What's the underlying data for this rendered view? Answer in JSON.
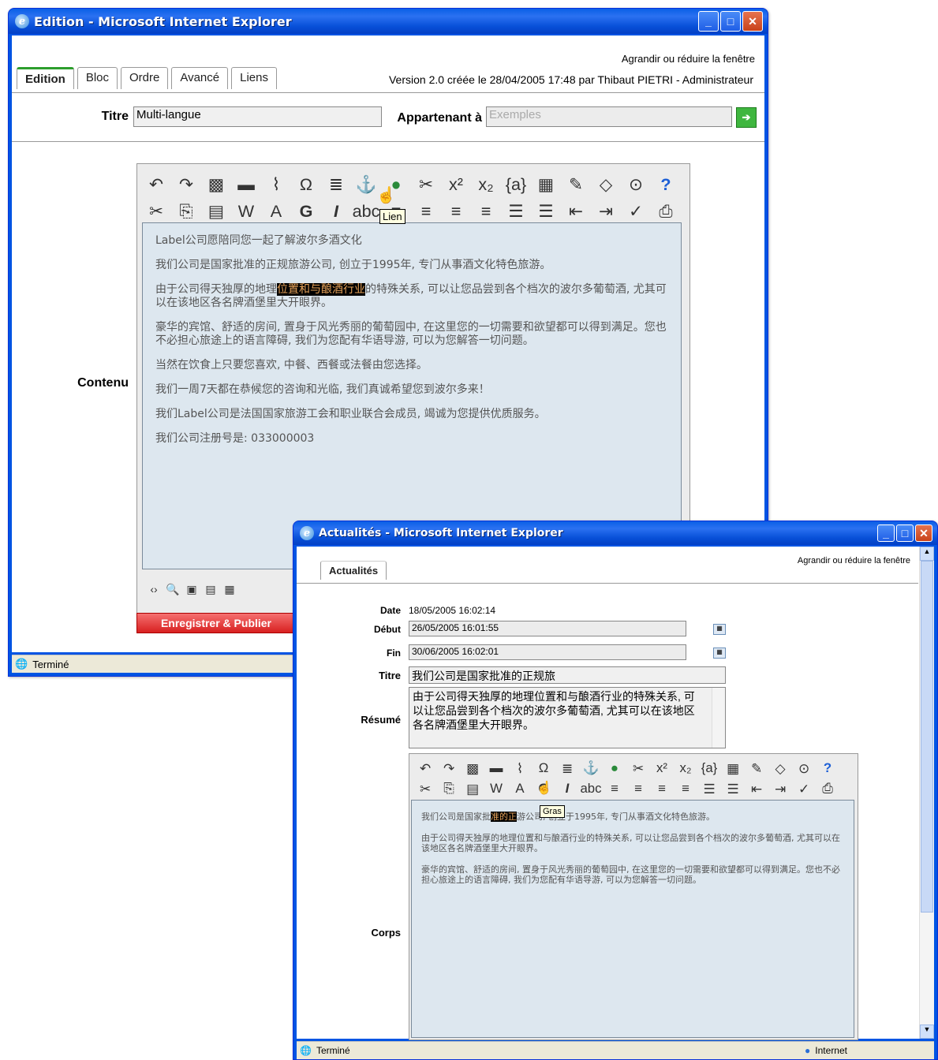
{
  "edition": {
    "title": "Edition - Microsoft Internet Explorer",
    "resize_link": "Agrandir ou réduire la fenêtre",
    "tabs": [
      "Edition",
      "Bloc",
      "Ordre",
      "Avancé",
      "Liens"
    ],
    "version_text": "Version 2.0 créée le 28/04/2005 17:48 par Thibaut PIETRI - Administrateur",
    "titre_label": "Titre",
    "titre_value": "Multi-langue",
    "appartenant_label": "Appartenant à",
    "appartenant_placeholder": "Exemples",
    "contenu_label": "Contenu",
    "tooltip": "Lien",
    "paragraphs": [
      "Label公司愿陪同您一起了解波尔多酒文化",
      "我们公司是国家批准的正规旅游公司, 创立于1995年, 专门从事酒文化特色旅游。",
      "由于公司得天独厚的地理位置和与酿酒行业的特殊关系, 可以让您品尝到各个档次的波尔多葡萄酒, 尤其可以在该地区各名牌酒堡里大开眼界。",
      "豪华的宾馆、舒适的房间, 置身于风光秀丽的葡萄园中, 在这里您的一切需要和欲望都可以得到满足。您也不必担心旅途上的语言障碍, 我们为您配有华语导游, 可以为您解答一切问题。",
      "当然在饮食上只要您喜欢, 中餐、西餐或法餐由您选择。",
      "我们一周7天都在恭候您的咨询和光临, 我们真诚希望您到波尔多来！",
      "我们Label公司是法国国家旅游工会和职业联合会成员, 竭诚为您提供优质服务。",
      "我们公司注册号是: 033000003"
    ],
    "p3_pre": "由于公司得天独厚的地理",
    "p3_hl": "位置和与酿酒行业",
    "p3_post": "的特殊关系, 可以让您品尝到各个档次的波尔多葡萄酒, 尤其可以在该地区各名牌酒堡里大开眼界。",
    "save_button": "Enregistrer & Publier",
    "status": "Terminé"
  },
  "actualites": {
    "title": "Actualités - Microsoft Internet Explorer",
    "resize_link": "Agrandir ou réduire la fenêtre",
    "tab": "Actualités",
    "date_label": "Date",
    "date_value": "18/05/2005 16:02:14",
    "debut_label": "Début",
    "debut_value": "26/05/2005 16:01:55",
    "fin_label": "Fin",
    "fin_value": "30/06/2005 16:02:01",
    "titre_label": "Titre",
    "titre_value": "我们公司是国家批准的正规旅",
    "resume_label": "Résumé",
    "resume_value": "由于公司得天独厚的地理位置和与酿酒行业的特殊关系, 可以让您品尝到各个档次的波尔多葡萄酒, 尤其可以在该地区各名牌酒堡里大开眼界。",
    "corps_label": "Corps",
    "tooltip": "Gras",
    "p1_pre": "我们公司是国家批",
    "p1_hl": "准的正",
    "p1_post": "游公司, 创立于1995年, 专门从事酒文化特色旅游。",
    "p2": "由于公司得天独厚的地理位置和与酿酒行业的特殊关系, 可以让您品尝到各个档次的波尔多葡萄酒, 尤其可以在该地区各名牌酒堡里大开眼界。",
    "p3": "豪华的宾馆、舒适的房间, 置身于风光秀丽的葡萄园中, 在这里您的一切需要和欲望都可以得到满足。您也不必担心旅途上的语言障碍, 我们为您配有华语导游, 可以为您解答一切问题。",
    "status": "Terminé",
    "zone": "Internet"
  },
  "toolbar_icons_row1": [
    "undo-icon",
    "redo-icon",
    "image-icon",
    "flash-icon",
    "attachment-icon",
    "omega-icon",
    "rule-icon",
    "anchor-icon",
    "link-icon",
    "unlink-icon",
    "superscript-icon",
    "subscript-icon",
    "variable-icon",
    "table-icon",
    "edit-icon",
    "eraser-icon",
    "find-icon",
    "help-icon"
  ],
  "toolbar_icons_row2": [
    "cut-icon",
    "copy-icon",
    "paste-icon",
    "word-paste-icon",
    "font-color-icon",
    "bold-icon",
    "italic-icon",
    "strike-icon",
    "align-left-icon",
    "align-center-icon",
    "align-right-icon",
    "justify-icon",
    "ordered-list-icon",
    "unordered-list-icon",
    "outdent-icon",
    "indent-icon",
    "spellcheck-icon",
    "print-icon"
  ]
}
